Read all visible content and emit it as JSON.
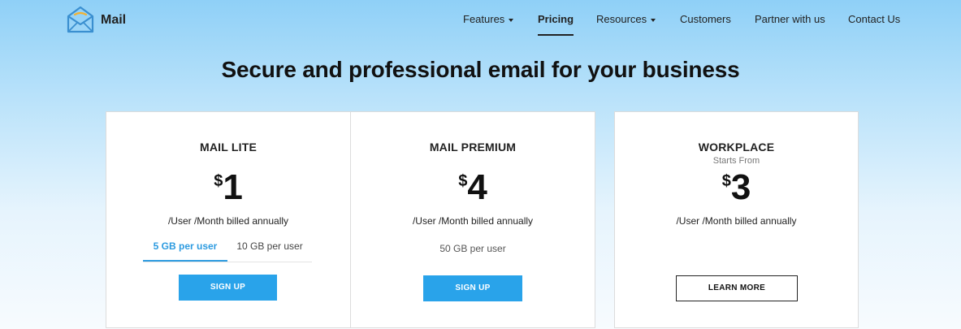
{
  "brand": {
    "name": "Mail",
    "logo_icon": "envelope-icon",
    "accent": "#2d9be0"
  },
  "nav": {
    "features": "Features",
    "pricing": "Pricing",
    "resources": "Resources",
    "customers": "Customers",
    "partner": "Partner with us",
    "contact": "Contact Us",
    "active": "Pricing"
  },
  "hero": {
    "headline": "Secure and professional email for your business"
  },
  "plans": [
    {
      "name": "MAIL LITE",
      "currency": "$",
      "price": "1",
      "billing": "/User /Month billed annually",
      "tabs": [
        "5 GB per user",
        "10 GB per user"
      ],
      "selected_tab": "5 GB per user",
      "cta": "SIGN UP"
    },
    {
      "name": "MAIL PREMIUM",
      "currency": "$",
      "price": "4",
      "billing": "/User /Month billed annually",
      "storage": "50 GB per user",
      "cta": "SIGN UP"
    },
    {
      "name": "WORKPLACE",
      "starts_from": "Starts From",
      "currency": "$",
      "price": "3",
      "billing": "/User /Month billed annually",
      "cta": "LEARN MORE"
    }
  ],
  "colors": {
    "button_blue": "#29a3ea",
    "tab_active": "#2d9be0",
    "background_top": "#8fd0f7"
  }
}
